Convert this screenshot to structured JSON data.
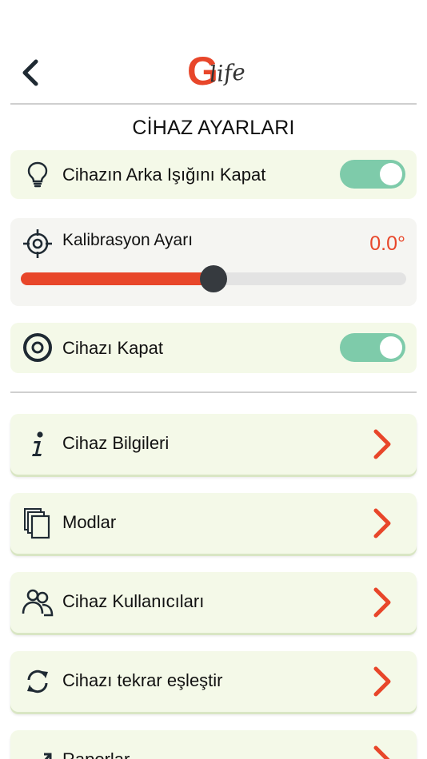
{
  "header": {
    "logo_letter": "G",
    "logo_word": "life",
    "back_icon": "chevron-left-icon"
  },
  "page_title": "CİHAZ AYARLARI",
  "settings": {
    "backlight": {
      "label": "Cihazın Arka Işığını Kapat",
      "icon": "lightbulb-icon",
      "enabled": true
    },
    "calibration": {
      "label": "Kalibrasyon Ayarı",
      "icon": "crosshair-icon",
      "value_text": "0.0°",
      "slider_fraction": 0.5
    },
    "power_off": {
      "label": "Cihazı Kapat",
      "icon": "power-ring-icon",
      "enabled": true
    }
  },
  "menu": [
    {
      "label": "Cihaz Bilgileri",
      "icon": "info-icon"
    },
    {
      "label": "Modlar",
      "icon": "layers-icon"
    },
    {
      "label": "Cihaz Kullanıcıları",
      "icon": "users-icon"
    },
    {
      "label": "Cihazı tekrar eşleştir",
      "icon": "sync-icon"
    },
    {
      "label": "Raporlar",
      "icon": "chart-trend-icon"
    }
  ],
  "colors": {
    "accent": "#e8462a",
    "toggle_on": "#7ecbaa",
    "card_bg": "#f4f9e8",
    "thumb": "#363a3f"
  }
}
